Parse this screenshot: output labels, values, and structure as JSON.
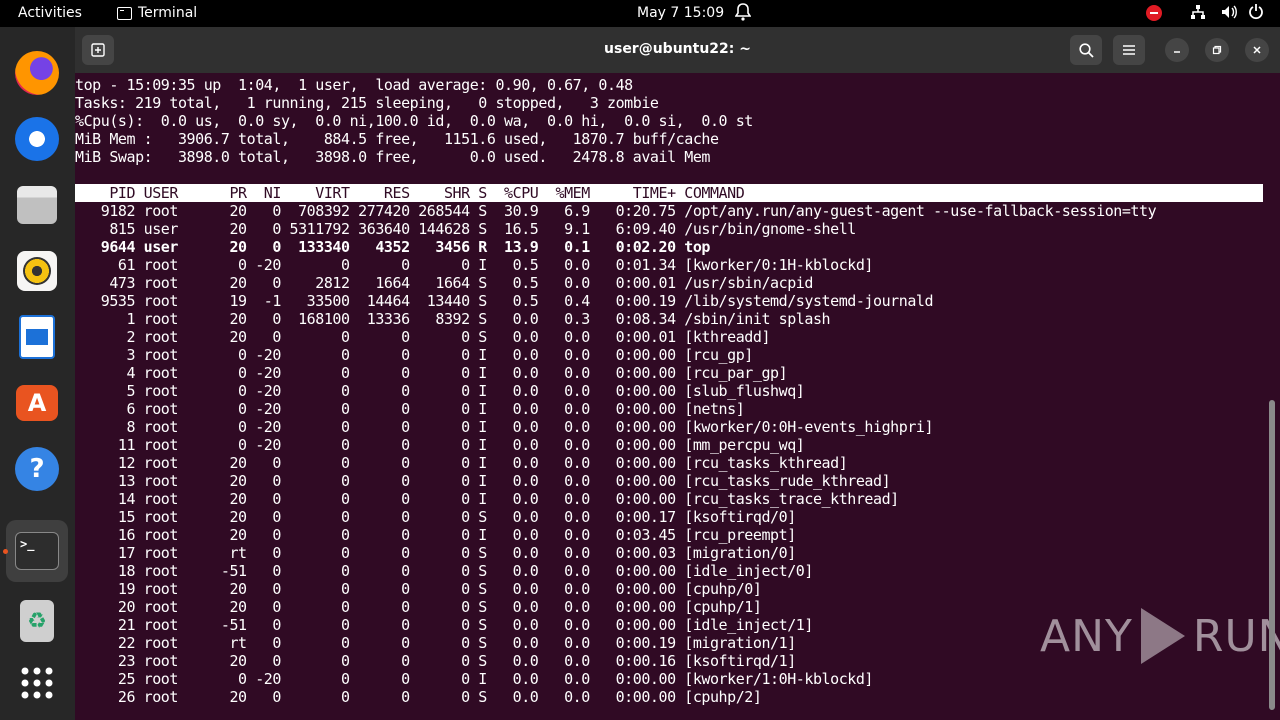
{
  "topbar": {
    "activities": "Activities",
    "app_name": "Terminal",
    "clock": "May 7  15:09"
  },
  "dock": {
    "items": [
      "firefox-icon",
      "thunderbird-icon",
      "files-icon",
      "rhythmbox-icon",
      "libreoffice-writer-icon",
      "app-center-icon",
      "help-icon",
      "terminal-icon",
      "trash-icon",
      "show-apps-icon"
    ]
  },
  "window": {
    "title": "user@ubuntu22: ~"
  },
  "top": {
    "summary": [
      "top - 15:09:35 up  1:04,  1 user,  load average: 0.90, 0.67, 0.48",
      "Tasks: 219 total,   1 running, 215 sleeping,   0 stopped,   3 zombie",
      "%Cpu(s):  0.0 us,  0.0 sy,  0.0 ni,100.0 id,  0.0 wa,  0.0 hi,  0.0 si,  0.0 st",
      "MiB Mem :   3906.7 total,    884.5 free,   1151.6 used,   1870.7 buff/cache",
      "MiB Swap:   3898.0 total,   3898.0 free,      0.0 used.   2478.8 avail Mem"
    ],
    "header": "    PID USER      PR  NI    VIRT    RES    SHR S  %CPU  %MEM     TIME+ COMMAND",
    "rows": [
      "   9182 root      20   0  708392 277420 268544 S  30.9   6.9   0:20.75 /opt/any.run/any-guest-agent --use-fallback-session=tty",
      "    815 user      20   0 5311792 363640 144628 S  16.5   9.1   6:09.40 /usr/bin/gnome-shell",
      "   9644 user      20   0  133340   4352   3456 R  13.9   0.1   0:02.20 top",
      "     61 root       0 -20       0      0      0 I   0.5   0.0   0:01.34 [kworker/0:1H-kblockd]",
      "    473 root      20   0    2812   1664   1664 S   0.5   0.0   0:00.01 /usr/sbin/acpid",
      "   9535 root      19  -1   33500  14464  13440 S   0.5   0.4   0:00.19 /lib/systemd/systemd-journald",
      "      1 root      20   0  168100  13336   8392 S   0.0   0.3   0:08.34 /sbin/init splash",
      "      2 root      20   0       0      0      0 S   0.0   0.0   0:00.01 [kthreadd]",
      "      3 root       0 -20       0      0      0 I   0.0   0.0   0:00.00 [rcu_gp]",
      "      4 root       0 -20       0      0      0 I   0.0   0.0   0:00.00 [rcu_par_gp]",
      "      5 root       0 -20       0      0      0 I   0.0   0.0   0:00.00 [slub_flushwq]",
      "      6 root       0 -20       0      0      0 I   0.0   0.0   0:00.00 [netns]",
      "      8 root       0 -20       0      0      0 I   0.0   0.0   0:00.00 [kworker/0:0H-events_highpri]",
      "     11 root       0 -20       0      0      0 I   0.0   0.0   0:00.00 [mm_percpu_wq]",
      "     12 root      20   0       0      0      0 I   0.0   0.0   0:00.00 [rcu_tasks_kthread]",
      "     13 root      20   0       0      0      0 I   0.0   0.0   0:00.00 [rcu_tasks_rude_kthread]",
      "     14 root      20   0       0      0      0 I   0.0   0.0   0:00.00 [rcu_tasks_trace_kthread]",
      "     15 root      20   0       0      0      0 S   0.0   0.0   0:00.17 [ksoftirqd/0]",
      "     16 root      20   0       0      0      0 I   0.0   0.0   0:03.45 [rcu_preempt]",
      "     17 root      rt   0       0      0      0 S   0.0   0.0   0:00.03 [migration/0]",
      "     18 root     -51   0       0      0      0 S   0.0   0.0   0:00.00 [idle_inject/0]",
      "     19 root      20   0       0      0      0 S   0.0   0.0   0:00.00 [cpuhp/0]",
      "     20 root      20   0       0      0      0 S   0.0   0.0   0:00.00 [cpuhp/1]",
      "     21 root     -51   0       0      0      0 S   0.0   0.0   0:00.00 [idle_inject/1]",
      "     22 root      rt   0       0      0      0 S   0.0   0.0   0:00.19 [migration/1]",
      "     23 root      20   0       0      0      0 S   0.0   0.0   0:00.16 [ksoftirqd/1]",
      "     25 root       0 -20       0      0      0 I   0.0   0.0   0:00.00 [kworker/1:0H-kblockd]",
      "     26 root      20   0       0      0      0 S   0.0   0.0   0:00.00 [cpuhp/2]"
    ]
  },
  "watermark": {
    "left": "ANY",
    "right": "RUN"
  },
  "colors": {
    "terminal_bg": "#300a24",
    "ubuntu_orange": "#e95420",
    "header_bg": "#303030"
  }
}
